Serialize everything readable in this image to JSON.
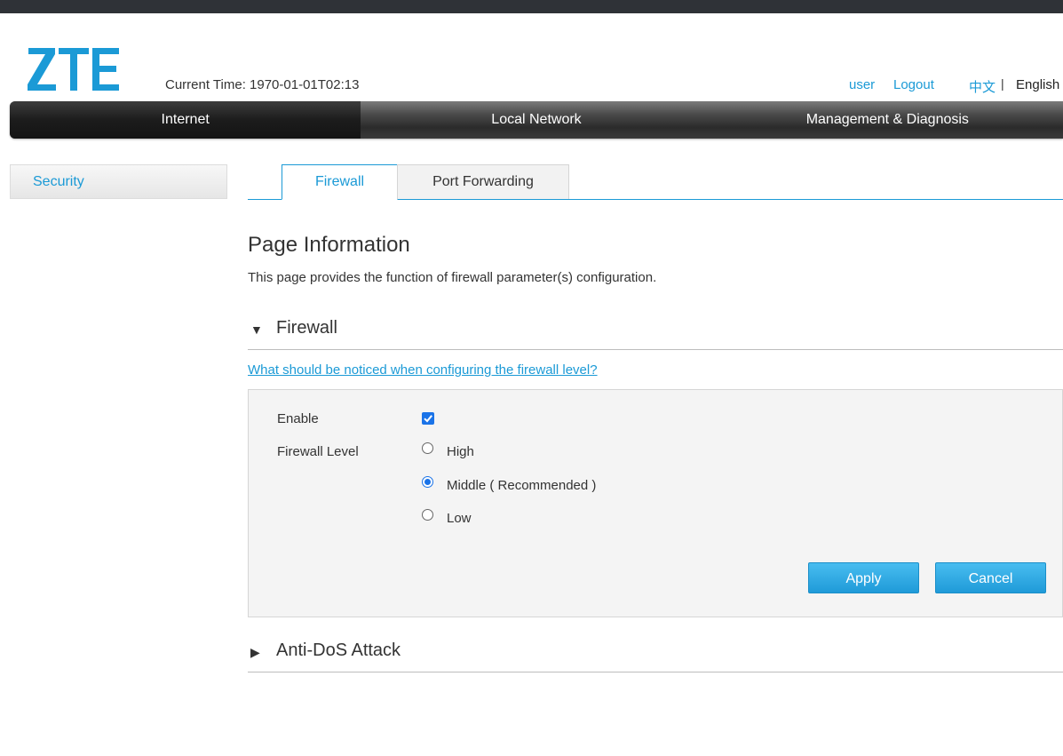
{
  "brand": {
    "logo_text": "ZTE",
    "color": "#1b9ad6"
  },
  "header": {
    "current_time_label": "Current Time: 1970-01-01T02:13",
    "user_link": "user",
    "logout_link": "Logout",
    "lang_zh": "中文",
    "lang_separator": "|",
    "lang_en": "English"
  },
  "nav": {
    "items": [
      {
        "label": "Internet",
        "active": true
      },
      {
        "label": "Local Network",
        "active": false
      },
      {
        "label": "Management & Diagnosis",
        "active": false
      }
    ]
  },
  "sidebar": {
    "items": [
      {
        "label": "Security"
      }
    ]
  },
  "tabs": [
    {
      "label": "Firewall",
      "active": true
    },
    {
      "label": "Port Forwarding",
      "active": false
    }
  ],
  "page": {
    "title": "Page Information",
    "description": "This page provides the function of firewall parameter(s) configuration."
  },
  "firewall_section": {
    "title": "Firewall",
    "expanded": true,
    "notice_link": "What should be noticed when configuring the firewall level?",
    "enable_label": "Enable",
    "enable_checked": true,
    "level_label": "Firewall Level",
    "levels": [
      {
        "label": "High",
        "selected": false
      },
      {
        "label": "Middle ( Recommended )",
        "selected": true
      },
      {
        "label": "Low",
        "selected": false
      }
    ],
    "apply_label": "Apply",
    "cancel_label": "Cancel"
  },
  "antidos_section": {
    "title": "Anti-DoS Attack",
    "expanded": false
  },
  "icons": {
    "expanded_arrow": "triangle-down-icon",
    "collapsed_arrow": "triangle-right-icon",
    "expanded_glyph": "▼",
    "collapsed_glyph": "▶"
  },
  "colors": {
    "accent": "#1b9ad6",
    "checkbox": "#1a73e8",
    "navbar": "#2b2b2b"
  }
}
